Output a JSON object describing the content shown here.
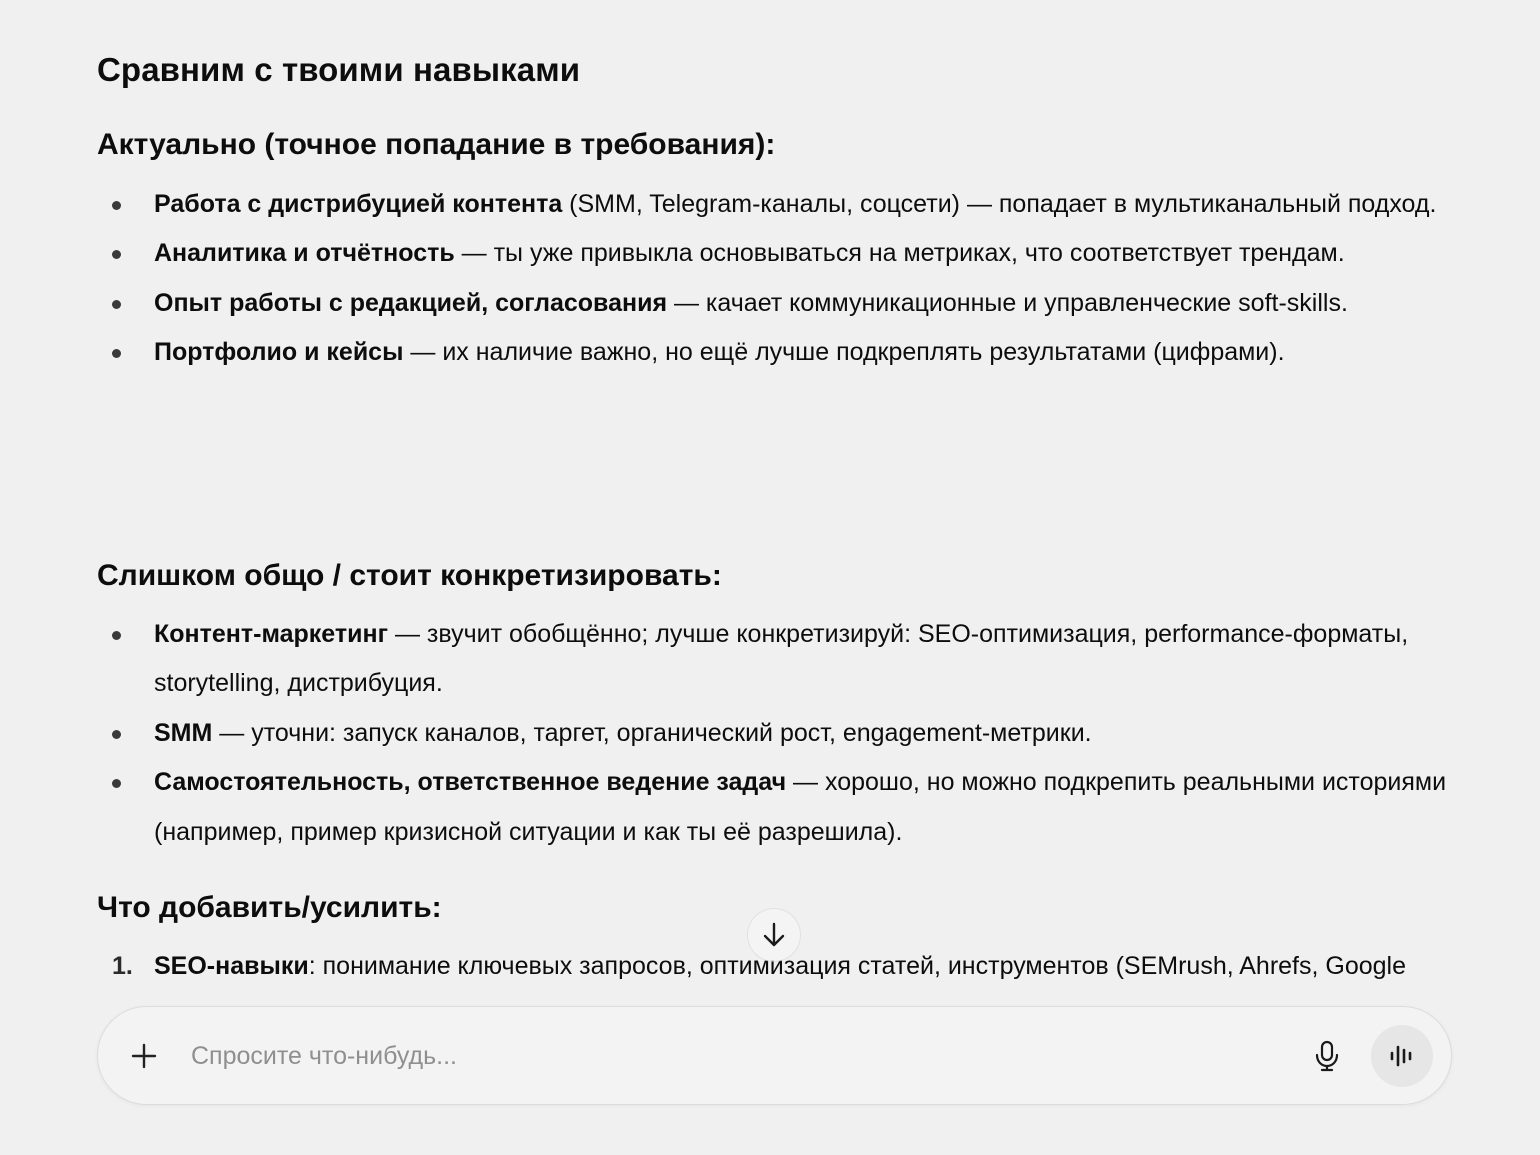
{
  "heading": "Сравним с твоими навыками",
  "sections": [
    {
      "title": "Актуально (точное попадание в требования):",
      "items": [
        {
          "bold": "Работа с дистрибуцией контента",
          "text": " (SMM, Telegram-каналы, соцсети) — попадает в мультиканальный подход."
        },
        {
          "bold": "Аналитика и отчётность",
          "text": " — ты уже привыкла основываться на метриках, что соответствует трендам."
        },
        {
          "bold": "Опыт работы с редакцией, согласования",
          "text": " — качает коммуникационные и управленческие soft-skills."
        },
        {
          "bold": "Портфолио и кейсы",
          "text": " — их наличие важно, но ещё лучше подкреплять результатами (цифрами)."
        }
      ]
    },
    {
      "title": "Слишком общо / стоит конкретизировать:",
      "items": [
        {
          "bold": "Контент-маркетинг",
          "text": " — звучит обобщённо; лучше конкретизируй: SEO-оптимизация, performance-форматы, storytelling, дистрибуция."
        },
        {
          "bold": "SMM",
          "text": " — уточни: запуск каналов, таргет, органический рост, engagement-метрики."
        },
        {
          "bold": "Самостоятельность, ответственное ведение задач",
          "text": " — хорошо, но можно подкрепить реальными историями (например, пример кризисной ситуации и как ты её разрешила)."
        }
      ]
    },
    {
      "title": "Что добавить/усилить:",
      "items": [
        {
          "number": "1.",
          "bold": "SEO-навыки",
          "text": ": понимание ключевых запросов, оптимизация статей, инструментов (SEMrush, Ahrefs, Google Search Console)."
        }
      ]
    }
  ],
  "composer": {
    "placeholder": "Спросите что-нибудь...",
    "value": ""
  },
  "icons": {
    "plus": "plus-icon",
    "mic": "microphone-icon",
    "voice": "voice-mode-icon",
    "scroll": "arrow-down-icon"
  }
}
